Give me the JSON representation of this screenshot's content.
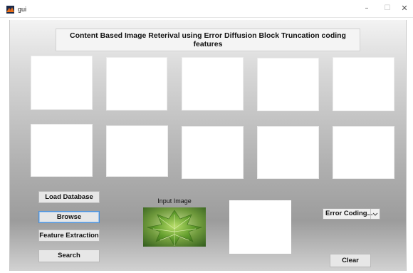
{
  "window": {
    "title": "gui",
    "icon": "matlab-icon",
    "controls": {
      "minimize": "–",
      "maximize": "☐",
      "close": "✕"
    }
  },
  "header": {
    "title": "Content Based Image Reterival using Error Diffusion Block Truncation coding features"
  },
  "result_grid": {
    "rows": 2,
    "columns": 5,
    "cells": [
      {
        "id": "result-1"
      },
      {
        "id": "result-2"
      },
      {
        "id": "result-3"
      },
      {
        "id": "result-4"
      },
      {
        "id": "result-5"
      },
      {
        "id": "result-6"
      },
      {
        "id": "result-7"
      },
      {
        "id": "result-8"
      },
      {
        "id": "result-9"
      },
      {
        "id": "result-10"
      }
    ]
  },
  "buttons": {
    "load_database": "Load Database",
    "browse": "Browse",
    "feature_extraction": "Feature Extraction",
    "search": "Search",
    "clear": "Clear"
  },
  "input_image": {
    "label": "Input Image",
    "content": "green-leaf-image"
  },
  "method_select": {
    "selected": "Error Coding...",
    "icon": "chevron-down-icon"
  },
  "colors": {
    "background_top": "#f3f3f3",
    "background_mid": "#a6a6a6",
    "button_face": "#e7e7e7",
    "focus_border": "#4a90d9"
  }
}
